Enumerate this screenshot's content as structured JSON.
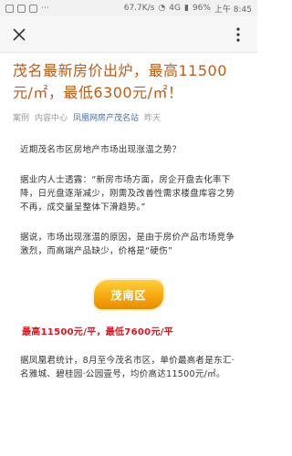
{
  "status": {
    "speed": "67.7K/s",
    "signal": "4G",
    "battery": "96%",
    "time": "上午 8:45"
  },
  "nav": {
    "close_icon": "close-icon",
    "more_icon": "more-icon"
  },
  "article": {
    "title": "茂名最新房价出炉，最高11500元/㎡，最低6300元/㎡！",
    "meta": {
      "tag": "案例",
      "channel": "内容中心",
      "source": "凤凰网房产茂名站",
      "date": "昨天"
    },
    "paragraphs": [
      "近期茂名市区房地产市场出现涨温之势？",
      "据业内人士透露：“新房市场方面，房企开盘去化率下降，日光盘逐渐减少，刚需及改善性需求楼盘库容之势不再，成交量呈整体下滑趋势。”",
      "据说，市场出现涨温的原因，是由于房价产品市场竞争激烈，而高端产品缺少，价格是“硬伤”"
    ],
    "banner_label": "茂南区",
    "price_line": "最高11500元/平，最低7600元/平",
    "last_paragraph": "据凤凰君统计，8月至今茂名市区，单价最高者是东汇·名雅城、碧桂园·公园壹号，均价高达11500元/㎡。"
  }
}
